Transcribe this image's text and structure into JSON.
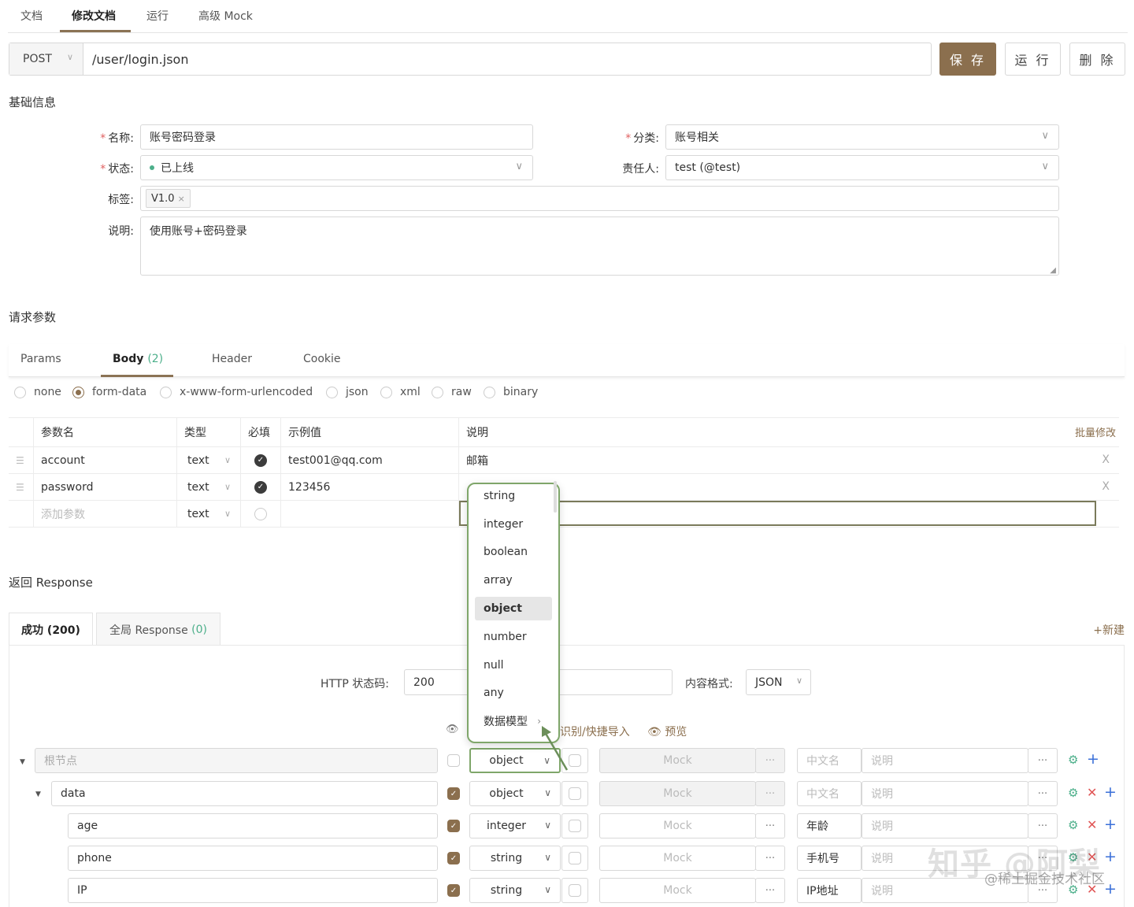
{
  "top_tabs": [
    "文档",
    "修改文档",
    "运行",
    "高级 Mock"
  ],
  "request": {
    "method": "POST",
    "url": "/user/login.json",
    "save_label": "保 存",
    "run_label": "运 行",
    "delete_label": "删 除"
  },
  "basic": {
    "title": "基础信息",
    "name_label": "名称:",
    "name_value": "账号密码登录",
    "category_label": "分类:",
    "category_value": "账号相关",
    "status_label": "状态:",
    "status_value": "已上线",
    "owner_label": "责任人:",
    "owner_value": "test (@test)",
    "tags_label": "标签:",
    "tag": "V1.0",
    "desc_label": "说明:",
    "desc_value": "使用账号+密码登录"
  },
  "req_params": {
    "title": "请求参数",
    "tabs": [
      "Params",
      "Body",
      "Header",
      "Cookie"
    ],
    "body_count": "(2)",
    "body_types": [
      "none",
      "form-data",
      "x-www-form-urlencoded",
      "json",
      "xml",
      "raw",
      "binary"
    ],
    "columns": [
      "参数名",
      "类型",
      "必填",
      "示例值",
      "说明"
    ],
    "batch_edit": "批量修改",
    "rows": [
      {
        "name": "account",
        "type": "text",
        "example": "test001@qq.com",
        "desc": "邮箱"
      },
      {
        "name": "password",
        "type": "text",
        "example": "123456",
        "desc": ""
      }
    ],
    "add_placeholder": "添加参数",
    "add_type": "text"
  },
  "response": {
    "title": "返回 Response",
    "tab_success": "成功 (200)",
    "tab_global": "全局 Response",
    "global_count": "(0)",
    "new_label": "+新建",
    "status_label": "HTTP 状态码:",
    "status_value": "200",
    "format_label": "内容格式:",
    "format_value": "JSON",
    "import_label": "识别/快捷导入",
    "preview_label": "预览",
    "root_placeholder": "根节点",
    "mock_placeholder": "Mock",
    "cn_placeholder": "中文名",
    "desc_placeholder": "说明",
    "dots": "···",
    "fields": [
      {
        "name": "data",
        "type": "object",
        "cn": ""
      },
      {
        "name": "age",
        "type": "integer",
        "cn": "年龄"
      },
      {
        "name": "phone",
        "type": "string",
        "cn": "手机号"
      },
      {
        "name": "IP",
        "type": "string",
        "cn": "IP地址"
      }
    ],
    "root_type": "object"
  },
  "type_dropdown": [
    "string",
    "integer",
    "boolean",
    "array",
    "object",
    "number",
    "null",
    "any",
    "数据模型"
  ],
  "type_dropdown_selected": "object",
  "watermark": {
    "main": "知乎 @阿梨",
    "sub": "@稀土掘金技术社区"
  },
  "colors": {
    "accent": "#8b6f4e",
    "green": "#4caf8a",
    "danger": "#e05555",
    "blue": "#3a6fd8",
    "highlight": "#7fa66a"
  }
}
